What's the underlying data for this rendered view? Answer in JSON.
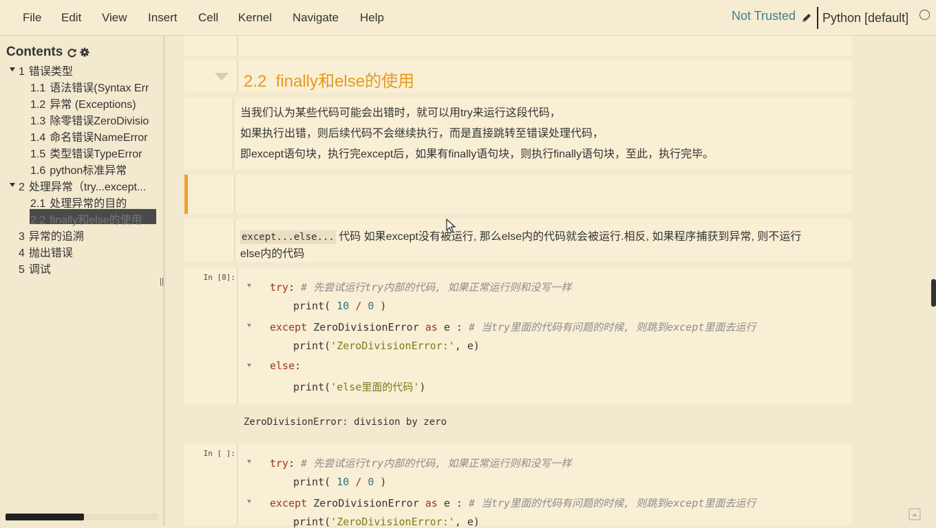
{
  "menubar": {
    "items": [
      "File",
      "Edit",
      "View",
      "Insert",
      "Cell",
      "Kernel",
      "Navigate",
      "Help"
    ],
    "trust_status": "Not Trusted",
    "kernel_name": "Python [default]"
  },
  "toc": {
    "title": "Contents",
    "items": [
      {
        "num": "1",
        "label": "错误类型"
      },
      {
        "num": "1.1",
        "label": "语法错误(Syntax Err"
      },
      {
        "num": "1.2",
        "label": "异常 (Exceptions)"
      },
      {
        "num": "1.3",
        "label": "除零错误ZeroDivisio"
      },
      {
        "num": "1.4",
        "label": "命名错误NameError"
      },
      {
        "num": "1.5",
        "label": "类型错误TypeError"
      },
      {
        "num": "1.6",
        "label": "python标准异常"
      },
      {
        "num": "2",
        "label": "处理异常（try...except..."
      },
      {
        "num": "2.1",
        "label": "处理异常的目的"
      },
      {
        "num": "2.2",
        "label": "finally和else的使用"
      },
      {
        "num": "3",
        "label": "异常的追溯"
      },
      {
        "num": "4",
        "label": "抛出错误"
      },
      {
        "num": "5",
        "label": "调试"
      }
    ]
  },
  "cells": {
    "heading": {
      "num": "2.2",
      "text": "finally和else的使用"
    },
    "md1": [
      "当我们认为某些代码可能会出错时，就可以用try来运行这段代码，",
      "如果执行出错，则后续代码不会继续执行，而是直接跳转至错误处理代码，",
      "即except语句块，执行完except后，如果有finally语句块，则执行finally语句块，至此，执行完毕。"
    ],
    "md2": {
      "code": "except...else...",
      "text_line1": " 代码 如果except没有被运行, 那么else内的代码就会被运行.相反, 如果程序捕获到异常, 则不运行",
      "text_line2": "else内的代码"
    },
    "code1": {
      "prompt": "In [8]:",
      "lines": {
        "try": "try",
        "c1": "# 先尝试运行try内部的代码, 如果正常运行则和没写一样",
        "print": "print",
        "n10": "10",
        "n0": "0",
        "except": "except",
        "err": "ZeroDivisionError",
        "as": "as",
        "e": "e",
        "c2": "# 当try里面的代码有问题的时候, 则跳到except里面去运行",
        "s1": "'ZeroDivisionError:'",
        "else": "else",
        "s2": "'else里面的代码'"
      }
    },
    "output": "ZeroDivisionError: division by zero",
    "code2": {
      "prompt": "In [ ]:"
    }
  }
}
